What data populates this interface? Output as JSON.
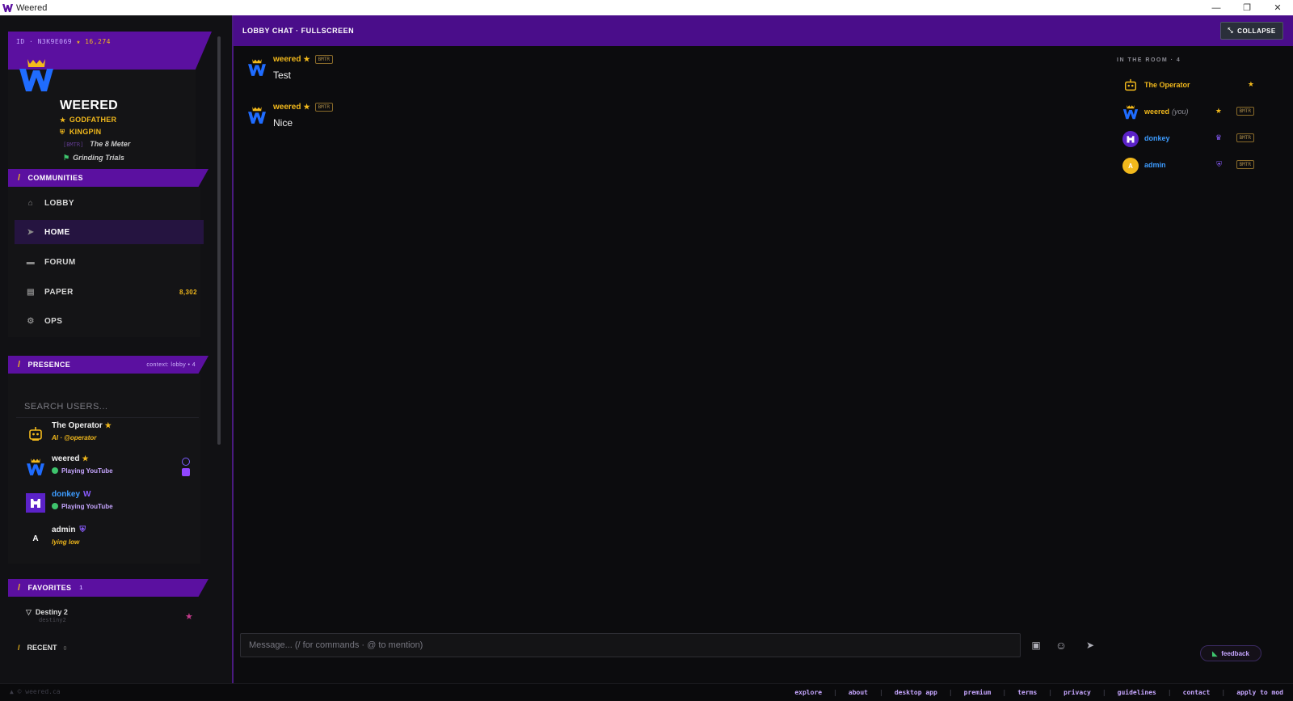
{
  "window": {
    "title": "Weered"
  },
  "profile": {
    "id_text": "ID · N3K9E069",
    "points": "16,274",
    "name": "WEERED",
    "ranks": [
      "GODFATHER",
      "KINGPIN"
    ],
    "tag_bmtr": "[BMTR]",
    "tag_title": "The 8 Meter",
    "activity": "Grinding Trials"
  },
  "communities": {
    "header": "COMMUNITIES",
    "items": [
      {
        "label": "LOBBY",
        "icon": "home-icon"
      },
      {
        "label": "HOME",
        "icon": "cursor-icon"
      },
      {
        "label": "FORUM",
        "icon": "chat-icon"
      },
      {
        "label": "PAPER",
        "icon": "money-icon",
        "count": "8,302"
      },
      {
        "label": "OPS",
        "icon": "gear-icon"
      }
    ]
  },
  "presence": {
    "header": "PRESENCE",
    "context": "context: lobby • 4",
    "search_placeholder": "SEARCH USERS...",
    "users": [
      {
        "name": "The Operator",
        "sub": "AI · @operator"
      },
      {
        "name": "weered",
        "sub": "Playing YouTube"
      },
      {
        "name": "donkey",
        "sub": "Playing YouTube"
      },
      {
        "name": "admin",
        "sub": "lying low",
        "avatar_letter": "A"
      }
    ]
  },
  "favorites": {
    "header": "FAVORITES",
    "count": "1",
    "items": [
      {
        "name": "Destiny 2",
        "sub": "destiny2"
      }
    ]
  },
  "recent": {
    "header": "RECENT",
    "count": "0"
  },
  "chat": {
    "title": "LOBBY CHAT · FULLSCREEN",
    "collapse_label": "COLLAPSE",
    "messages": [
      {
        "user": "weered",
        "chip": "BMTR",
        "text": "Test"
      },
      {
        "user": "weered",
        "chip": "BMTR",
        "text": "Nice"
      }
    ],
    "room_title": "IN THE ROOM · 4",
    "room": [
      {
        "name": "The Operator"
      },
      {
        "name": "weered",
        "you": "(you)",
        "chip": "BMTR"
      },
      {
        "name": "donkey",
        "chip": "BMTR"
      },
      {
        "name": "admin",
        "chip": "BMTR",
        "avatar_letter": "A"
      }
    ],
    "composer_placeholder": "Message... (/ for commands · @ to mention)",
    "feedback_label": "feedback"
  },
  "footer": {
    "copy": "▲ © weered.ca",
    "links": [
      "explore",
      "about",
      "desktop app",
      "premium",
      "terms",
      "privacy",
      "guidelines",
      "contact",
      "apply to mod"
    ]
  },
  "colors": {
    "accent": "#5b10a0",
    "gold": "#f2b91c",
    "blue": "#3d9cff",
    "background": "#0c0c0e"
  }
}
